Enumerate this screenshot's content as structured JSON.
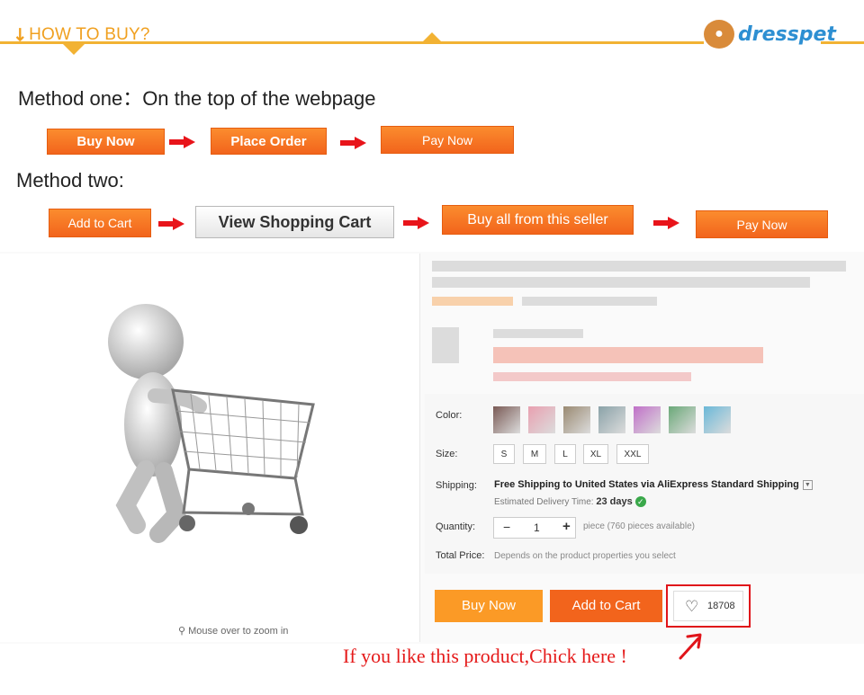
{
  "header": {
    "title": "HOW TO BUY?",
    "logo_text": "dresspet",
    "logo_icon": "dog-mascot-icon"
  },
  "method_one": {
    "title": "Method one：On the top of the webpage",
    "steps": [
      "Buy Now",
      "Place Order",
      "Pay Now"
    ]
  },
  "method_two": {
    "title": "Method two:",
    "steps": [
      "Add to Cart",
      "View Shopping Cart",
      "Buy all from this seller",
      "Pay Now"
    ]
  },
  "product": {
    "zoom_hint": "Mouse over to zoom in",
    "labels": {
      "color": "Color:",
      "size": "Size:",
      "shipping": "Shipping:",
      "quantity": "Quantity:",
      "total": "Total Price:"
    },
    "sizes": [
      "S",
      "M",
      "L",
      "XL",
      "XXL"
    ],
    "color_swatches": [
      "#7a5a55",
      "#e9a0b0",
      "#9a8a72",
      "#8aa2a8",
      "#c070c8",
      "#6aa878",
      "#6ab8d8"
    ],
    "shipping_main": "Free Shipping to United States via AliExpress Standard Shipping",
    "shipping_dropdown_icon": "chevron-down-icon",
    "delivery_label": "Estimated Delivery Time:",
    "delivery_value": "23 days",
    "quantity_minus": "−",
    "quantity_value": "1",
    "quantity_plus": "+",
    "quantity_avail": "piece (760 pieces available)",
    "total_value": "Depends on the product properties you select",
    "buy_now": "Buy Now",
    "add_to_cart": "Add to Cart",
    "wish_count": "18708"
  },
  "callout": {
    "text": "If you like this product,Chick here !"
  },
  "colors": {
    "accent_orange": "#f2641c",
    "header_yellow": "#f2b233",
    "highlight_red": "#e0141a"
  }
}
